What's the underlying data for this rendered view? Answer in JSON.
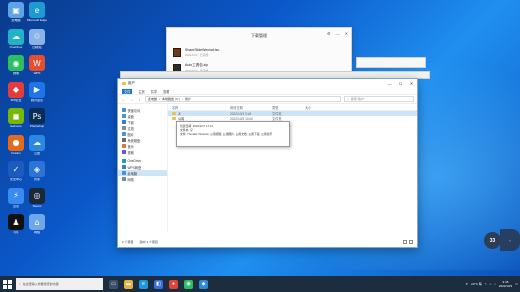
{
  "desktop": {
    "icons": [
      {
        "name": "此电脑",
        "color": "#5da3e8",
        "glyph": "▣"
      },
      {
        "name": "Microsoft Edge",
        "color": "#1d9ad6",
        "glyph": "e"
      },
      {
        "name": "OneDrive",
        "color": "#20b3c8",
        "glyph": "☁"
      },
      {
        "name": "回收站",
        "color": "#8ab4e8",
        "glyph": "♲"
      },
      {
        "name": "微信",
        "color": "#2dbe60",
        "glyph": "◉"
      },
      {
        "name": "WPS",
        "color": "#e44d2e",
        "glyph": "W"
      },
      {
        "name": "360安全",
        "color": "#e23c3c",
        "glyph": "◆"
      },
      {
        "name": "腾讯会议",
        "color": "#1d75e8",
        "glyph": "▶"
      },
      {
        "name": "GeForce",
        "color": "#76b900",
        "glyph": "◼"
      },
      {
        "name": "Photoshop",
        "color": "#0a2d55",
        "glyph": "Ps"
      },
      {
        "name": "Firefox",
        "color": "#e56a1c",
        "glyph": "●"
      },
      {
        "name": "云盘",
        "color": "#2b87e0",
        "glyph": "☁"
      },
      {
        "name": "安全中心",
        "color": "#1d5bbf",
        "glyph": "✓"
      },
      {
        "name": "管家",
        "color": "#2d74d9",
        "glyph": "◈"
      },
      {
        "name": "迅雷",
        "color": "#3a8af0",
        "glyph": "⚡"
      },
      {
        "name": "Steam",
        "color": "#1b2838",
        "glyph": "◎"
      },
      {
        "name": "QQ",
        "color": "#111111",
        "glyph": "♟"
      },
      {
        "name": "网络",
        "color": "#6fa8e8",
        "glyph": "⌂"
      }
    ]
  },
  "download_window": {
    "title": "下载管理",
    "items": [
      {
        "name": "ShareSlideWechat.iso",
        "meta": "2022/10/3 · 已完成"
      },
      {
        "name": "Auto工具包.zip",
        "meta": "2022/10/3 · 已完成"
      }
    ]
  },
  "explorer": {
    "title": "用户",
    "ribbon": [
      "文件",
      "主页",
      "共享",
      "查看"
    ],
    "address": [
      "此电脑",
      "本地磁盘 (C:)",
      "用户"
    ],
    "search_placeholder": "搜索\"用户\"",
    "nav": [
      {
        "label": "快速访问",
        "color": "#4a90d9",
        "sel": false
      },
      {
        "label": "桌面",
        "color": "#4a90d9",
        "sel": false
      },
      {
        "label": "下载",
        "color": "#2c7de0",
        "sel": false
      },
      {
        "label": "文档",
        "color": "#8a8a8a",
        "sel": false
      },
      {
        "label": "图片",
        "color": "#3a9ad9",
        "sel": false
      },
      {
        "label": "系统磁盘",
        "color": "#6a6a6a",
        "sel": false
      },
      {
        "label": "音乐",
        "color": "#d97a3a",
        "sel": false
      },
      {
        "label": "视频",
        "color": "#6a5acd",
        "sel": false
      },
      {
        "label": "OneDrive",
        "color": "#1d9ad6",
        "sel": false
      },
      {
        "label": "WPS网盘",
        "color": "#3a7ad9",
        "sel": false
      },
      {
        "label": "此电脑",
        "color": "#4a90d9",
        "sel": true
      },
      {
        "label": "网络",
        "color": "#6a8ab9",
        "sel": false
      }
    ],
    "columns": {
      "name": "名称",
      "date": "修改日期",
      "type": "类型",
      "size": "大小"
    },
    "rows": [
      {
        "name": "Ji",
        "date": "2022/10/3 9:44",
        "type": "文件夹",
        "size": "",
        "sel": true
      },
      {
        "name": "公用",
        "date": "2022/10/3 10:00",
        "type": "文件夹",
        "size": "",
        "sel": false
      }
    ],
    "status": [
      "2 个项目",
      "选中 1 个项目"
    ]
  },
  "tooltip": {
    "line1": "创建日期: 2019/12/7 17:14",
    "line2": "文件夹: 空",
    "line3": "文件: Thunder Network, 公用视频, 公用图片, 公用文档, 公用下载, 公用音乐"
  },
  "badge": {
    "value": "33"
  },
  "taskbar": {
    "search_placeholder": "在这里输入你要搜索的内容",
    "apps": [
      {
        "name": "task-view",
        "color": "#3c4f66",
        "glyph": "▭"
      },
      {
        "name": "file-explorer",
        "color": "#e6b33c",
        "glyph": "▬"
      },
      {
        "name": "edge",
        "color": "#1d9ad6",
        "glyph": "e"
      },
      {
        "name": "store",
        "color": "#3a6fd9",
        "glyph": "◧"
      },
      {
        "name": "chrome",
        "color": "#db4437",
        "glyph": "●"
      },
      {
        "name": "wechat",
        "color": "#2dbe60",
        "glyph": "◉"
      },
      {
        "name": "qq-browser",
        "color": "#2b87e0",
        "glyph": "◆"
      }
    ],
    "tray_text": "22°C 晴",
    "time": "9:45",
    "date": "2022/10/3"
  }
}
